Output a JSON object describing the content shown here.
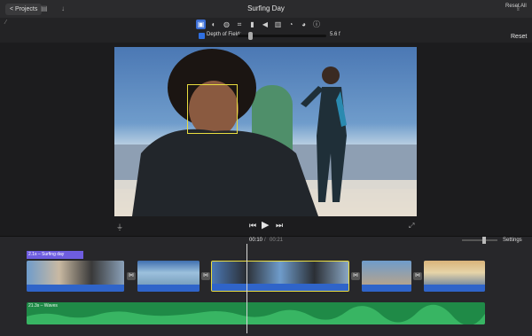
{
  "titlebar": {
    "projects_label": "< Projects",
    "title": "Surfing Day",
    "icons": [
      "media-library-icon",
      "download-icon",
      "share-icon"
    ]
  },
  "inspector": {
    "tools": [
      {
        "name": "cinematic-video-icon",
        "glyph": "▣",
        "active": true
      },
      {
        "name": "color-balance-icon",
        "glyph": "◐"
      },
      {
        "name": "color-correction-icon",
        "glyph": "◍"
      },
      {
        "name": "crop-icon",
        "glyph": "⌗"
      },
      {
        "name": "stabilization-icon",
        "glyph": "▮"
      },
      {
        "name": "volume-icon",
        "glyph": "◀"
      },
      {
        "name": "noise-reduction-icon",
        "glyph": "▥"
      },
      {
        "name": "speed-icon",
        "glyph": "◔"
      },
      {
        "name": "clip-filter-icon",
        "glyph": "◕"
      },
      {
        "name": "info-icon",
        "glyph": "ⓘ"
      }
    ],
    "reset_all": "Reset All",
    "depth_of_field_label": "Depth of Field:",
    "depth_of_field_value": "5.6 f",
    "depth_of_field_level": 0.12,
    "reset": "Reset"
  },
  "viewer": {
    "face_tracking": true
  },
  "timeline": {
    "current_time": "00:10",
    "separator": "/",
    "total_time": "00:21",
    "settings": "Settings",
    "title_clip": "2.1s – Surfing day",
    "audio_clip": "21.3s – Waves"
  },
  "colors": {
    "accent": "#3d6fd6",
    "selection": "#e9dd3f",
    "audio": "#1f8a47",
    "title_clip": "#6e5de0"
  }
}
